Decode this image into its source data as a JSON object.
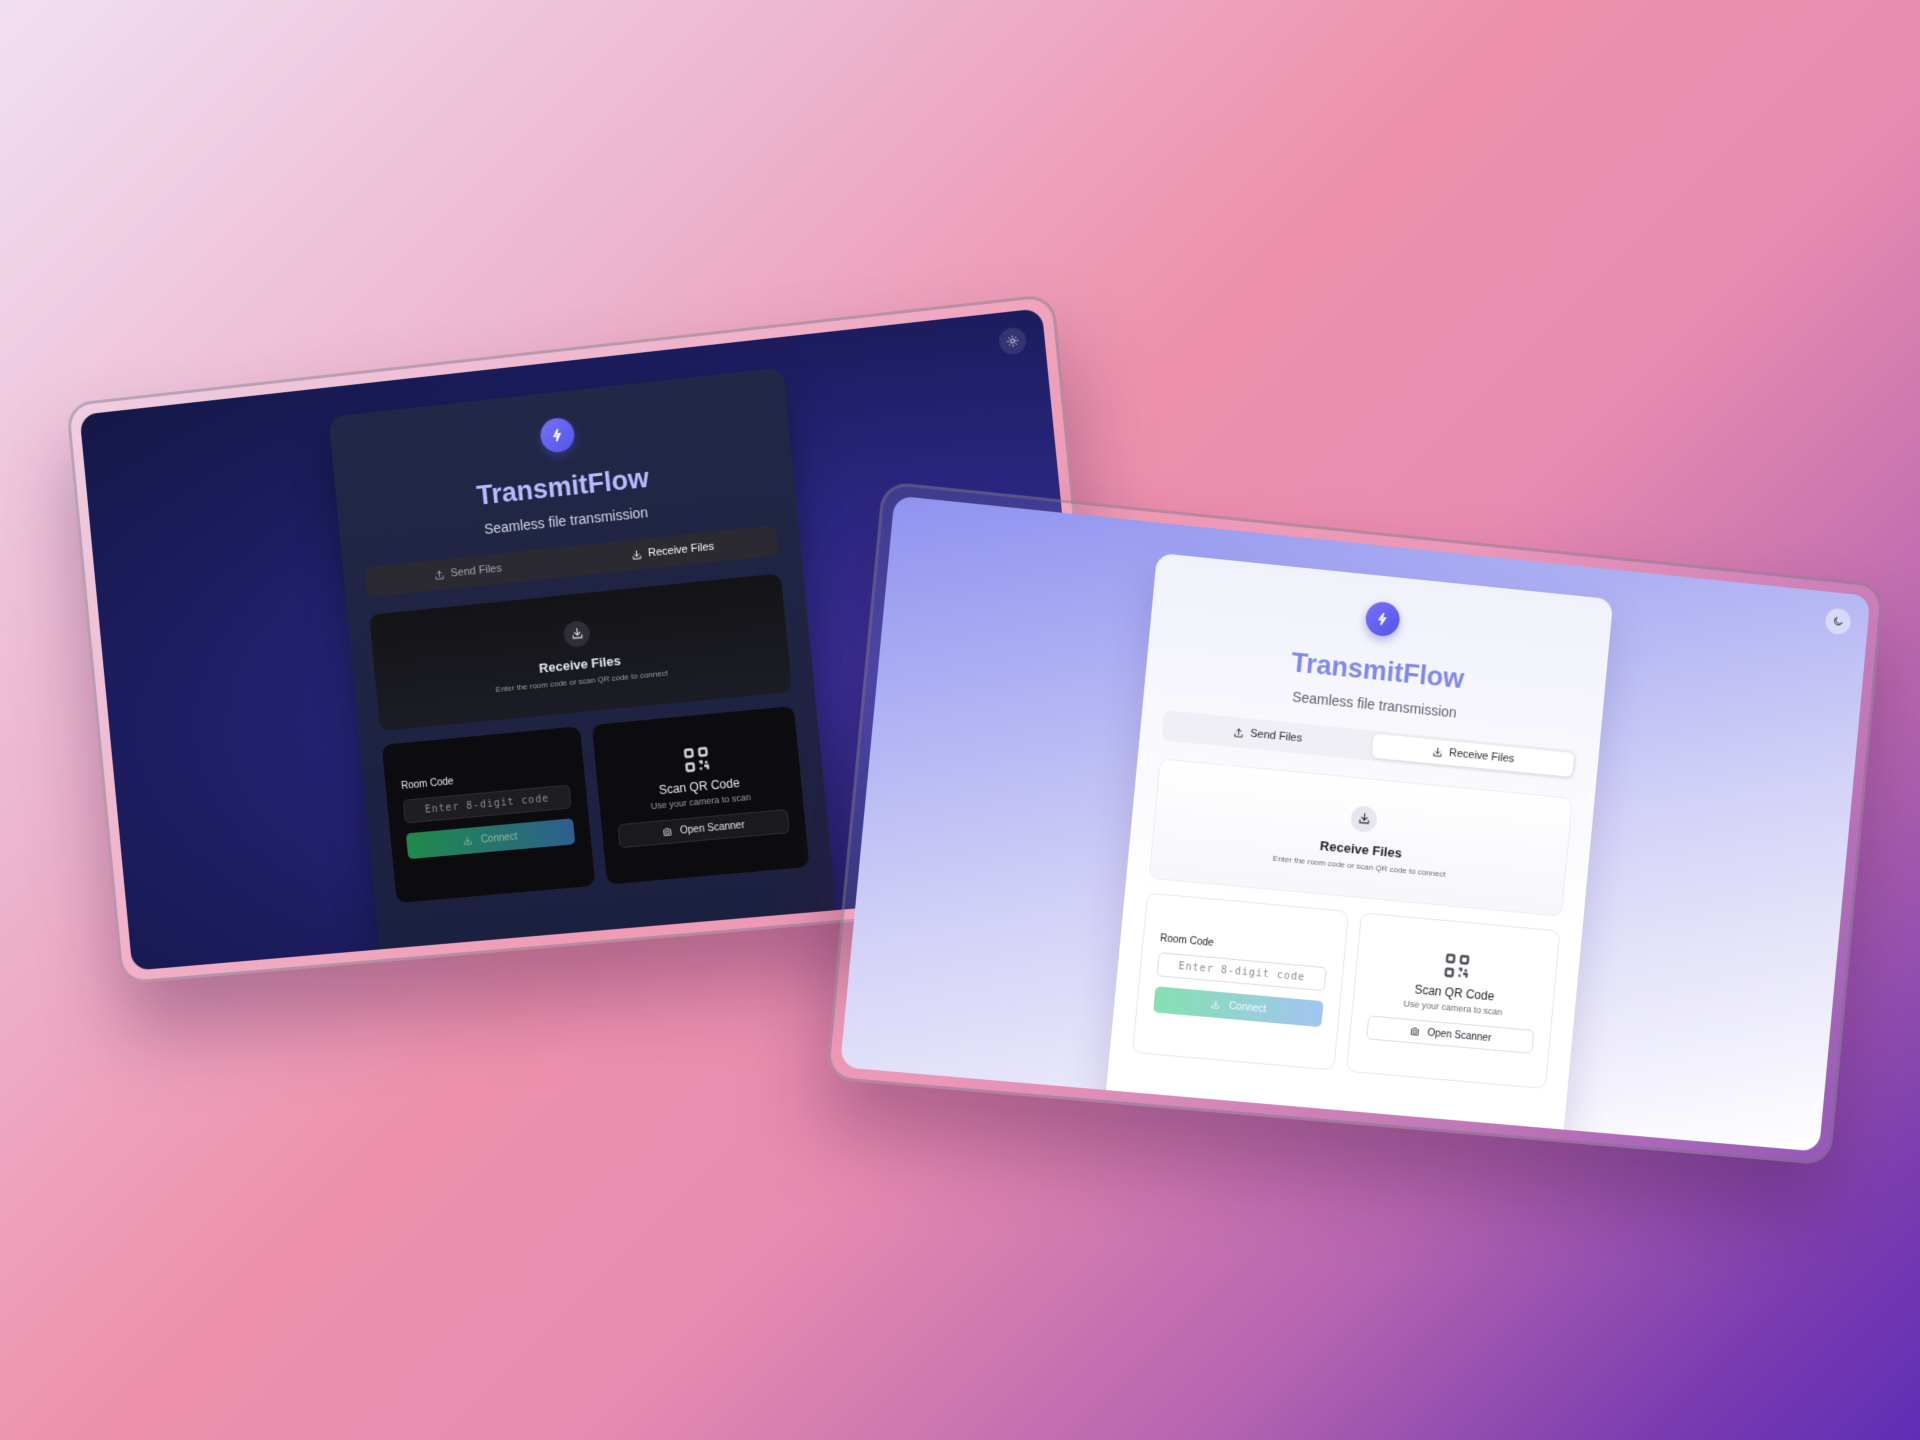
{
  "colors": {
    "accent": "#6366f1",
    "dark_title": "#b7bcff",
    "light_title": "#8088ee",
    "connect_start": "#1f8a4a",
    "connect_end": "#2e5f8e"
  },
  "dark_screen": {
    "theme_toggle_icon": "sun-icon",
    "app": {
      "logo_icon": "transmit-logo-icon",
      "title": "TransmitFlow",
      "subtitle": "Seamless file transmission"
    },
    "tabs": [
      {
        "label": "Send Files",
        "icon": "upload-icon",
        "active": false
      },
      {
        "label": "Receive Files",
        "icon": "download-icon",
        "active": true
      }
    ],
    "hero": {
      "icon": "download-icon",
      "title": "Receive Files",
      "description": "Enter the room code or scan QR code to connect"
    },
    "room_code": {
      "label": "Room Code",
      "placeholder": "Enter 8-digit code",
      "connect_label": "Connect"
    },
    "qr": {
      "icon": "qr-code-icon",
      "title": "Scan QR Code",
      "description": "Use your camera to scan",
      "button_label": "Open Scanner",
      "button_icon": "camera-icon"
    }
  },
  "light_screen": {
    "theme_toggle_icon": "moon-icon",
    "app": {
      "logo_icon": "transmit-logo-icon",
      "title": "TransmitFlow",
      "subtitle": "Seamless file transmission"
    },
    "tabs": [
      {
        "label": "Send Files",
        "icon": "upload-icon",
        "active": false
      },
      {
        "label": "Receive Files",
        "icon": "download-icon",
        "active": true
      }
    ],
    "hero": {
      "icon": "download-icon",
      "title": "Receive Files",
      "description": "Enter the room code or scan QR code to connect"
    },
    "room_code": {
      "label": "Room Code",
      "placeholder": "Enter 8-digit code",
      "connect_label": "Connect"
    },
    "qr": {
      "icon": "qr-code-icon",
      "title": "Scan QR Code",
      "description": "Use your camera to scan",
      "button_label": "Open Scanner",
      "button_icon": "camera-icon"
    }
  }
}
